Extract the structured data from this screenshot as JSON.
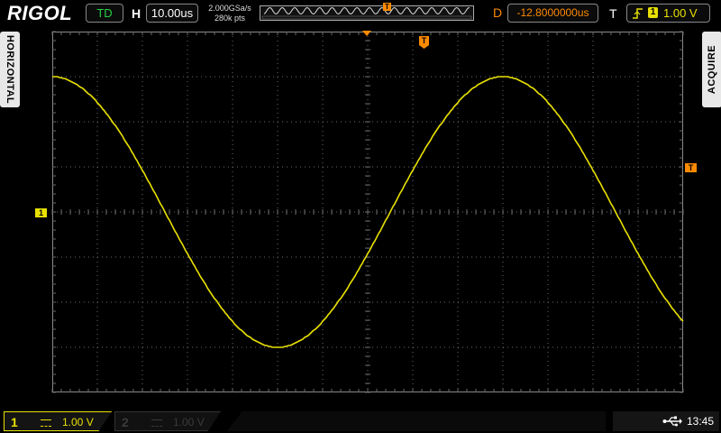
{
  "brand": "RIGOL",
  "top": {
    "run_mode": "TD",
    "h_label": "H",
    "timebase": "10.00us",
    "sample_rate": "2.000GSa/s",
    "memory_depth": "280k pts",
    "d_label": "D",
    "delay": "-12.8000000us",
    "t_label": "T",
    "trigger_source": "1",
    "trigger_level": "1.00 V",
    "trigger_slope_icon": "rising-edge-icon",
    "trigger_marker_glyph": "T"
  },
  "side_tabs": {
    "left": "HORIZONTAL",
    "right": "ACQUIRE"
  },
  "markers": {
    "ch1": "1",
    "trigger_level": "T",
    "trigger_position": "T"
  },
  "channels": [
    {
      "number": "1",
      "scale": "1.00 V",
      "active": true,
      "color": "#e8e000"
    },
    {
      "number": "2",
      "scale": "1.00 V",
      "active": false,
      "color": "#3a3a3a"
    }
  ],
  "status": {
    "time": "13:45",
    "usb_icon": "usb-icon"
  },
  "colors": {
    "ch1": "#e8e000",
    "trigger": "#ff8a00",
    "td": "#26d047",
    "grid": "#6a6a6a"
  },
  "waveform": {
    "shape": "sine",
    "amplitude_div": 3,
    "offset_div": 0,
    "period_div": 10,
    "phase_start": "peak"
  },
  "grid": {
    "hdivs": 14,
    "vdivs": 8
  }
}
